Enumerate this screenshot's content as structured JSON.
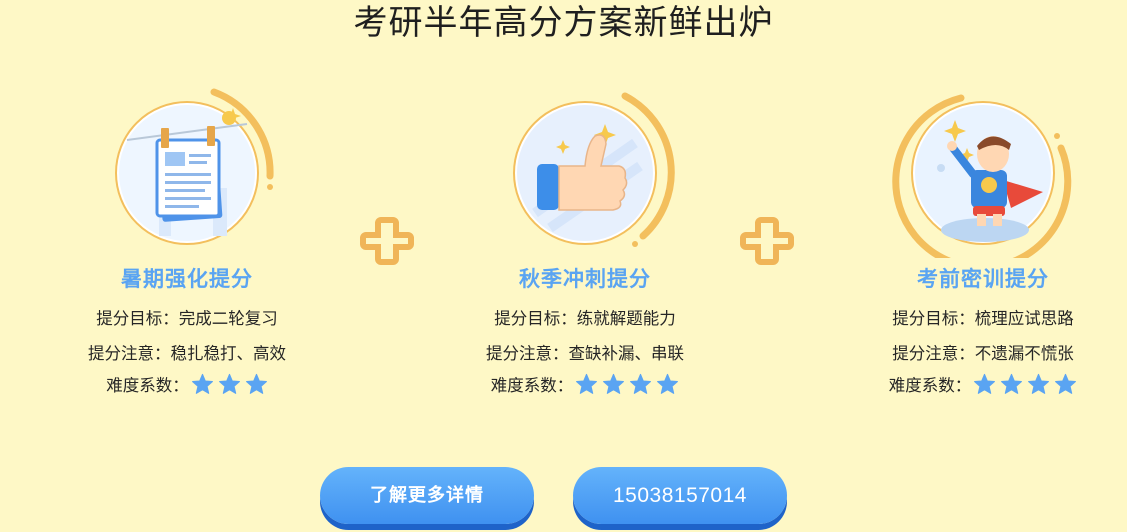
{
  "page": {
    "title": "考研半年高分方案新鲜出炉"
  },
  "stages": [
    {
      "title": "暑期强化提分",
      "goal": "提分目标：完成二轮复习",
      "note": "提分注意：稳扎稳打、高效",
      "difficulty_label": "难度系数：",
      "difficulty_stars": 3,
      "icon": "notebook-icon"
    },
    {
      "title": "秋季冲刺提分",
      "goal": "提分目标：练就解题能力",
      "note": "提分注意：查缺补漏、串联",
      "difficulty_label": "难度系数：",
      "difficulty_stars": 4,
      "icon": "thumbs-up-icon"
    },
    {
      "title": "考前密训提分",
      "goal": "提分目标：梳理应试思路",
      "note": "提分注意：不遗漏不慌张",
      "difficulty_label": "难度系数：",
      "difficulty_stars": 4,
      "icon": "superhero-icon"
    }
  ],
  "connectors": [
    "plus-icon",
    "plus-icon"
  ],
  "actions": {
    "more_label": "了解更多详情",
    "phone": "15038157014"
  },
  "colors": {
    "background": "#fef8c6",
    "accent_blue": "#5aa4f2",
    "plus_orange": "#f0b558",
    "arc_orange": "#f3bf5d",
    "button": "#4a9ef4"
  }
}
